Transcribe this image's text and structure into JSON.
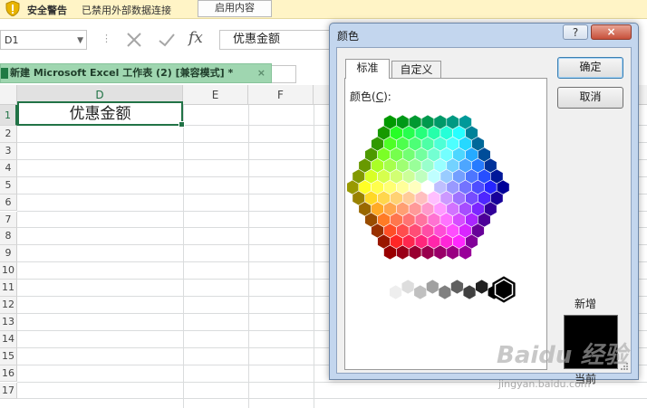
{
  "security_bar": {
    "title": "安全警告",
    "message": "已禁用外部数据连接",
    "enable_button": "启用内容"
  },
  "formula_bar": {
    "name_box": "D1",
    "cancel_icon": "x-icon",
    "enter_icon": "check-icon",
    "fx_label": "fx",
    "value": "优惠金额"
  },
  "workbook_tab": {
    "title": "新建 Microsoft Excel 工作表 (2)  [兼容模式] *",
    "close": "×"
  },
  "grid": {
    "columns": [
      "D",
      "E",
      "F"
    ],
    "selected_column": "D",
    "rows": [
      "1",
      "2",
      "3",
      "4",
      "5",
      "6",
      "7",
      "8",
      "9",
      "10",
      "11",
      "12",
      "13",
      "14",
      "15",
      "16",
      "17"
    ],
    "cell_D1": "优惠金额"
  },
  "dialog": {
    "title": "颜色",
    "help": "?",
    "close": "×",
    "tabs": [
      "标准",
      "自定义"
    ],
    "active_tab": "标准",
    "colors_label_prefix": "颜色(",
    "colors_label_key": "C",
    "colors_label_suffix": "):",
    "ok_button": "确定",
    "cancel_button": "取消",
    "new_label": "新增",
    "current_label": "当前",
    "new_color": "#000000",
    "selected_swatch": "black"
  },
  "watermark": {
    "logo": "Baidu 经验",
    "url": "jingyan.baidu.com"
  }
}
